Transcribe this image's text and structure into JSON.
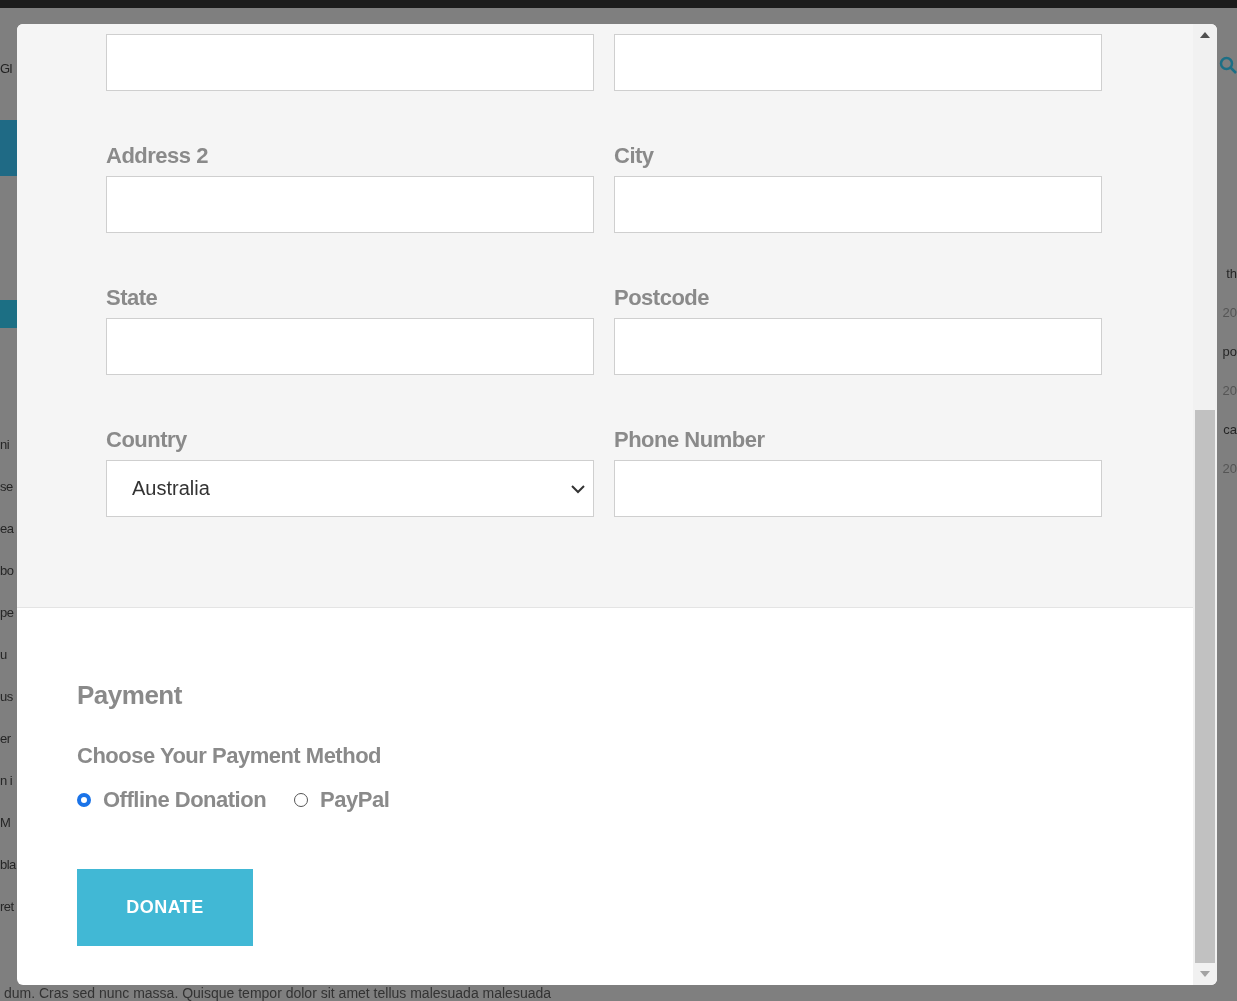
{
  "background": {
    "logo_fragment": "Gl",
    "left_fragments": [
      "ni",
      "se",
      "ea",
      "bo",
      "pe",
      "u",
      "us",
      "er",
      "n i",
      "M",
      "bla",
      "ret"
    ],
    "right_fragments": [
      "th",
      "20",
      "po",
      "20",
      "ca",
      "20"
    ],
    "bottom_text": "dum. Cras sed nunc massa. Quisque tempor dolor sit amet tellus malesuada malesuada"
  },
  "modal": {
    "fields": [
      {
        "kind": "text"
      },
      {
        "kind": "text"
      },
      {
        "kind": "text",
        "label": "Address 2"
      },
      {
        "kind": "text",
        "label": "City"
      },
      {
        "kind": "text",
        "label": "State"
      },
      {
        "kind": "text",
        "label": "Postcode"
      },
      {
        "kind": "select",
        "label": "Country",
        "value": "Australia"
      },
      {
        "kind": "text",
        "label": "Phone Number"
      }
    ],
    "payment": {
      "title": "Payment",
      "subtitle": "Choose Your Payment Method",
      "methods": [
        {
          "label": "Offline Donation",
          "selected": true
        },
        {
          "label": "PayPal",
          "selected": false
        }
      ]
    },
    "submit": "DONATE"
  }
}
